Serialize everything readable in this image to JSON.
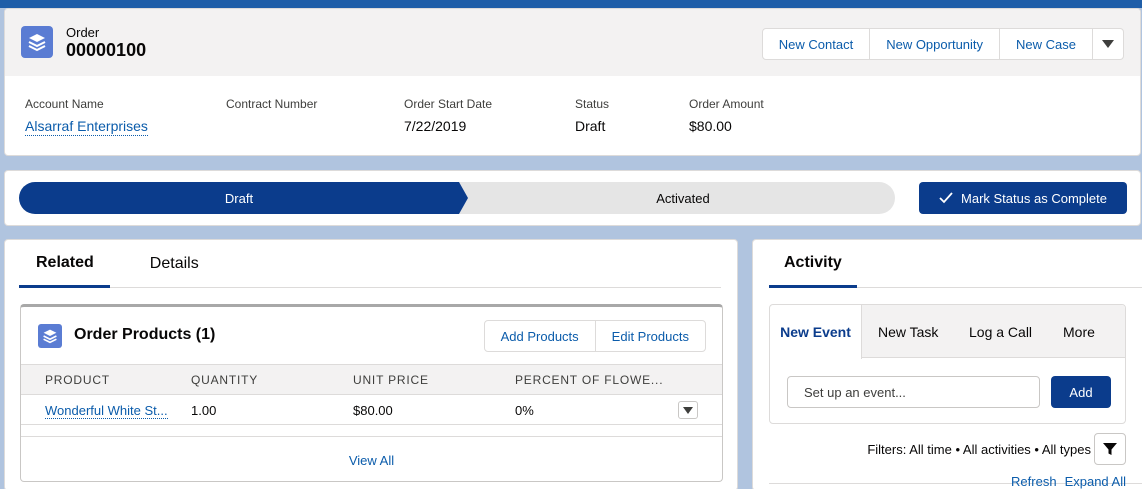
{
  "header": {
    "object_type": "Order",
    "record_number": "00000100",
    "actions": [
      "New Contact",
      "New Opportunity",
      "New Case"
    ]
  },
  "fields": [
    {
      "label": "Account Name",
      "value": "Alsarraf Enterprises"
    },
    {
      "label": "Contract Number",
      "value": ""
    },
    {
      "label": "Order Start Date",
      "value": "7/22/2019"
    },
    {
      "label": "Status",
      "value": "Draft"
    },
    {
      "label": "Order Amount",
      "value": "$80.00"
    }
  ],
  "path": {
    "stages": [
      "Draft",
      "Activated"
    ],
    "mark_button": "Mark Status as Complete"
  },
  "related": {
    "tabs": [
      "Related",
      "Details"
    ],
    "list_title": "Order Products (1)",
    "buttons": [
      "Add Products",
      "Edit Products"
    ],
    "columns": [
      "Product",
      "Quantity",
      "Unit Price",
      "Percent of Flowe..."
    ],
    "rows": [
      {
        "product": "Wonderful White St...",
        "quantity": "1.00",
        "unit_price": "$80.00",
        "percent": "0%"
      }
    ],
    "view_all": "View All"
  },
  "activity": {
    "tab": "Activity",
    "composer_tabs": [
      "New Event",
      "New Task",
      "Log a Call",
      "More"
    ],
    "input_placeholder": "Set up an event...",
    "add_button": "Add",
    "filters_text": "Filters: All time • All activities • All types",
    "links": [
      "Refresh",
      "Expand All"
    ]
  },
  "colors": {
    "brand": "#0b3c8c",
    "link": "#0b5cab",
    "object_icon": "#5a7cd3",
    "background": "#b0c4df"
  }
}
